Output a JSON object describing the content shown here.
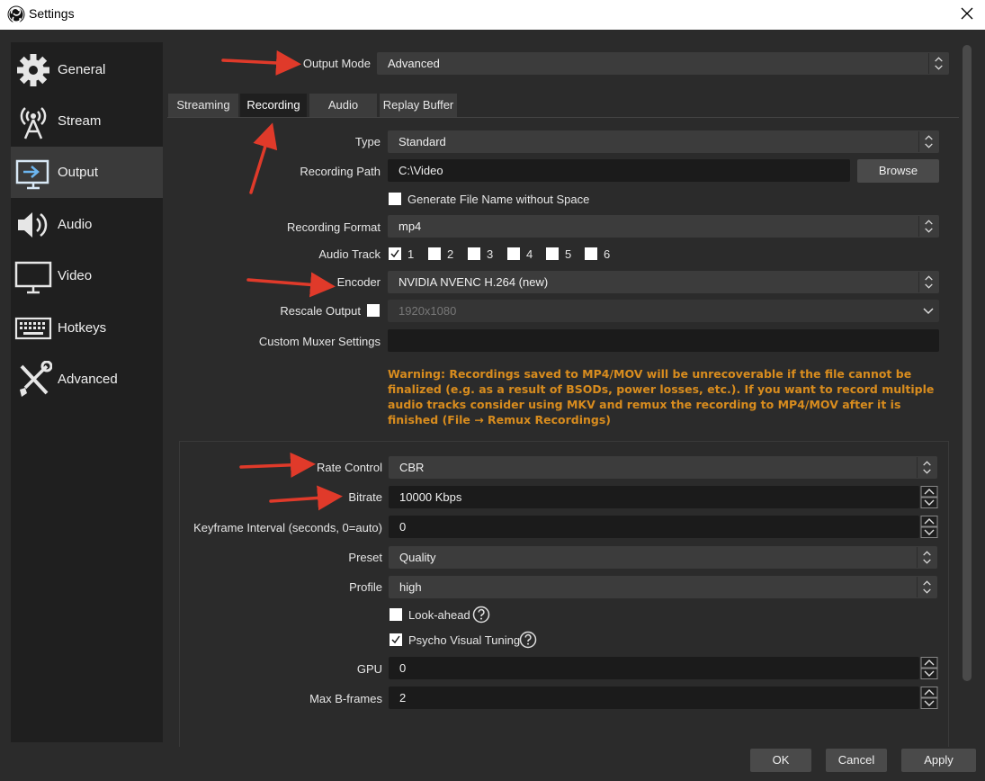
{
  "window": {
    "title": "Settings"
  },
  "sidebar": {
    "items": [
      {
        "label": "General",
        "icon": "gear-icon"
      },
      {
        "label": "Stream",
        "icon": "broadcast-icon"
      },
      {
        "label": "Output",
        "icon": "output-monitor-icon",
        "active": true
      },
      {
        "label": "Audio",
        "icon": "speaker-icon"
      },
      {
        "label": "Video",
        "icon": "monitor-icon"
      },
      {
        "label": "Hotkeys",
        "icon": "keyboard-icon"
      },
      {
        "label": "Advanced",
        "icon": "tools-icon"
      }
    ]
  },
  "output_mode": {
    "label": "Output Mode",
    "value": "Advanced"
  },
  "tabs": [
    "Streaming",
    "Recording",
    "Audio",
    "Replay Buffer"
  ],
  "active_tab": "Recording",
  "recording": {
    "type": {
      "label": "Type",
      "value": "Standard"
    },
    "path": {
      "label": "Recording Path",
      "value": "C:\\Video",
      "browse_label": "Browse"
    },
    "gen_filename": {
      "label": "Generate File Name without Space",
      "checked": false
    },
    "format": {
      "label": "Recording Format",
      "value": "mp4"
    },
    "audio_track": {
      "label": "Audio Track",
      "tracks": [
        {
          "label": "1",
          "checked": true
        },
        {
          "label": "2",
          "checked": false
        },
        {
          "label": "3",
          "checked": false
        },
        {
          "label": "4",
          "checked": false
        },
        {
          "label": "5",
          "checked": false
        },
        {
          "label": "6",
          "checked": false
        }
      ]
    },
    "encoder": {
      "label": "Encoder",
      "value": "NVIDIA NVENC H.264 (new)"
    },
    "rescale": {
      "label": "Rescale Output",
      "checked": false,
      "value": "1920x1080"
    },
    "muxer": {
      "label": "Custom Muxer Settings",
      "value": ""
    },
    "warning": "Warning: Recordings saved to MP4/MOV will be unrecoverable if the file cannot be finalized (e.g. as a result of BSODs, power losses, etc.). If you want to record multiple audio tracks consider using MKV and remux the recording to MP4/MOV after it is finished (File → Remux Recordings)"
  },
  "encoder_settings": {
    "rate_control": {
      "label": "Rate Control",
      "value": "CBR"
    },
    "bitrate": {
      "label": "Bitrate",
      "value": "10000 Kbps"
    },
    "keyframe": {
      "label": "Keyframe Interval (seconds, 0=auto)",
      "value": "0"
    },
    "preset": {
      "label": "Preset",
      "value": "Quality"
    },
    "profile": {
      "label": "Profile",
      "value": "high"
    },
    "lookahead": {
      "label": "Look-ahead",
      "checked": false
    },
    "psycho": {
      "label": "Psycho Visual Tuning",
      "checked": true
    },
    "gpu": {
      "label": "GPU",
      "value": "0"
    },
    "bframes": {
      "label": "Max B-frames",
      "value": "2"
    }
  },
  "footer": {
    "ok": "OK",
    "cancel": "Cancel",
    "apply": "Apply"
  },
  "colors": {
    "warning": "#d88c1e",
    "annotation_arrow": "#e03a2a",
    "background": "#2b2b2b"
  }
}
